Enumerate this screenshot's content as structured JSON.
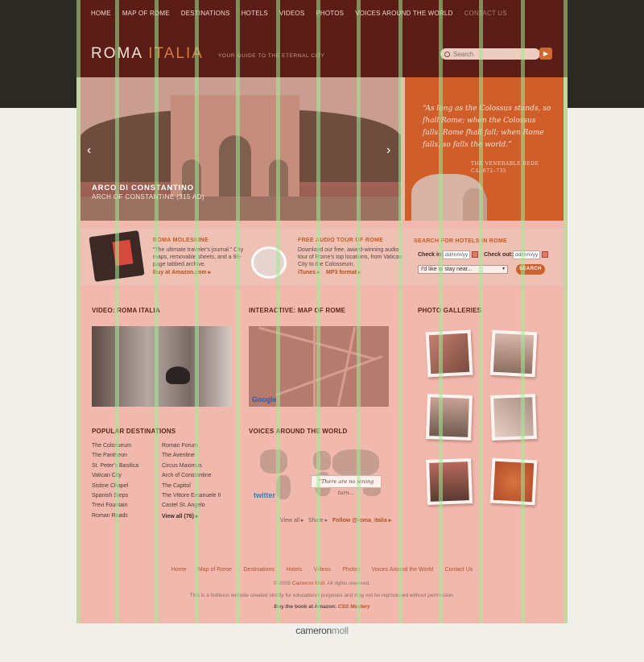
{
  "nav": {
    "items": [
      "HOME",
      "MAP OF ROME",
      "DESTINATIONS",
      "HOTELS",
      "VIDEOS",
      "PHOTOS",
      "VOICES AROUND THE WORLD",
      "CONTACT US"
    ]
  },
  "logo": {
    "main": "ROMA",
    "accent": "ITALIA"
  },
  "tagline": "YOUR GUIDE TO THE ETERNAL CITY",
  "search": {
    "placeholder": "Search",
    "go_icon": "arrow-right-icon"
  },
  "hero": {
    "title": "ARCO DI CONSTANTINO",
    "subtitle": "ARCH OF CONSTANTINE (315 AD)",
    "prev": "‹",
    "next": "›"
  },
  "quote": {
    "text": "“As long as the Colossus stands, so ſhall Rome; when the Colossus falls, Rome ſhall fall; when Rome falls, so falls the world.”",
    "author": "THE VENERABLE BEDE",
    "date": "CA. 672–735"
  },
  "promo1": {
    "title": "ROMA MOLESKINE",
    "body": "“The ultimate traveler's journal.” City maps, removable sheets, and a 96-page tabbed archive.",
    "link": "Buy at Amazon.com ▸"
  },
  "promo2": {
    "title": "FREE AUDIO TOUR OF ROME",
    "body": "Download our free, award-winning audio tour of Rome's top locations, from Vatican City to the Colosseum.",
    "link1": "iTunes ▸",
    "link2": "MP3 format ▸"
  },
  "hotels": {
    "title": "SEARCH FOR HOTELS IN ROME",
    "checkin_label": "Check in:",
    "checkout_label": "Check out:",
    "date_placeholder": "dd/mm/yy",
    "stay_select": "I'd like to stay near...",
    "button": "SEARCH"
  },
  "sections": {
    "video": "VIDEO: ROMA ITALIA",
    "map": "INTERACTIVE: MAP OF ROME",
    "photos": "PHOTO GALLERIES",
    "destinations": "POPULAR DESTINATIONS",
    "voices": "VOICES AROUND THE WORLD"
  },
  "map_brand": "Google",
  "destinations": {
    "col1": [
      "The Colosseum",
      "The Pantheon",
      "St. Peter's Basilica",
      "Vatican City",
      "Sistine Chapel",
      "Spanish Steps",
      "Trevi Fountain",
      "Roman Roads"
    ],
    "col2": [
      "Roman Forum",
      "The Aventine",
      "Circus Maximus",
      "Arch of Constantine",
      "The Capitol",
      "The Vittore Emanuele II",
      "Castel St. Angelo"
    ],
    "view_all": "View all (76) ▸"
  },
  "voices": {
    "bubble": "“There are no wrong turn…",
    "twitter": "twitter",
    "view_all": "View all ▸",
    "share": "Share ▸",
    "follow": "Follow @roma_italia ▸"
  },
  "footer": {
    "links": [
      "Home",
      "Map of Rome",
      "Destinations",
      "Hotels",
      "Videos",
      "Photos",
      "Voices Around the World",
      "Contact Us"
    ],
    "copyright_pre": "© 2009 ",
    "copyright_name": "Cameron Moll",
    "copyright_post": ". All rights reserved.",
    "disclaimer": "This is a fictitious website created strictly for educational purposes and may not be reproduced without permission.",
    "book_pre": "Buy the book at Amazon: ",
    "book_title": "CSS Mastery"
  },
  "credit": {
    "a": "cameron",
    "b": "moll"
  }
}
